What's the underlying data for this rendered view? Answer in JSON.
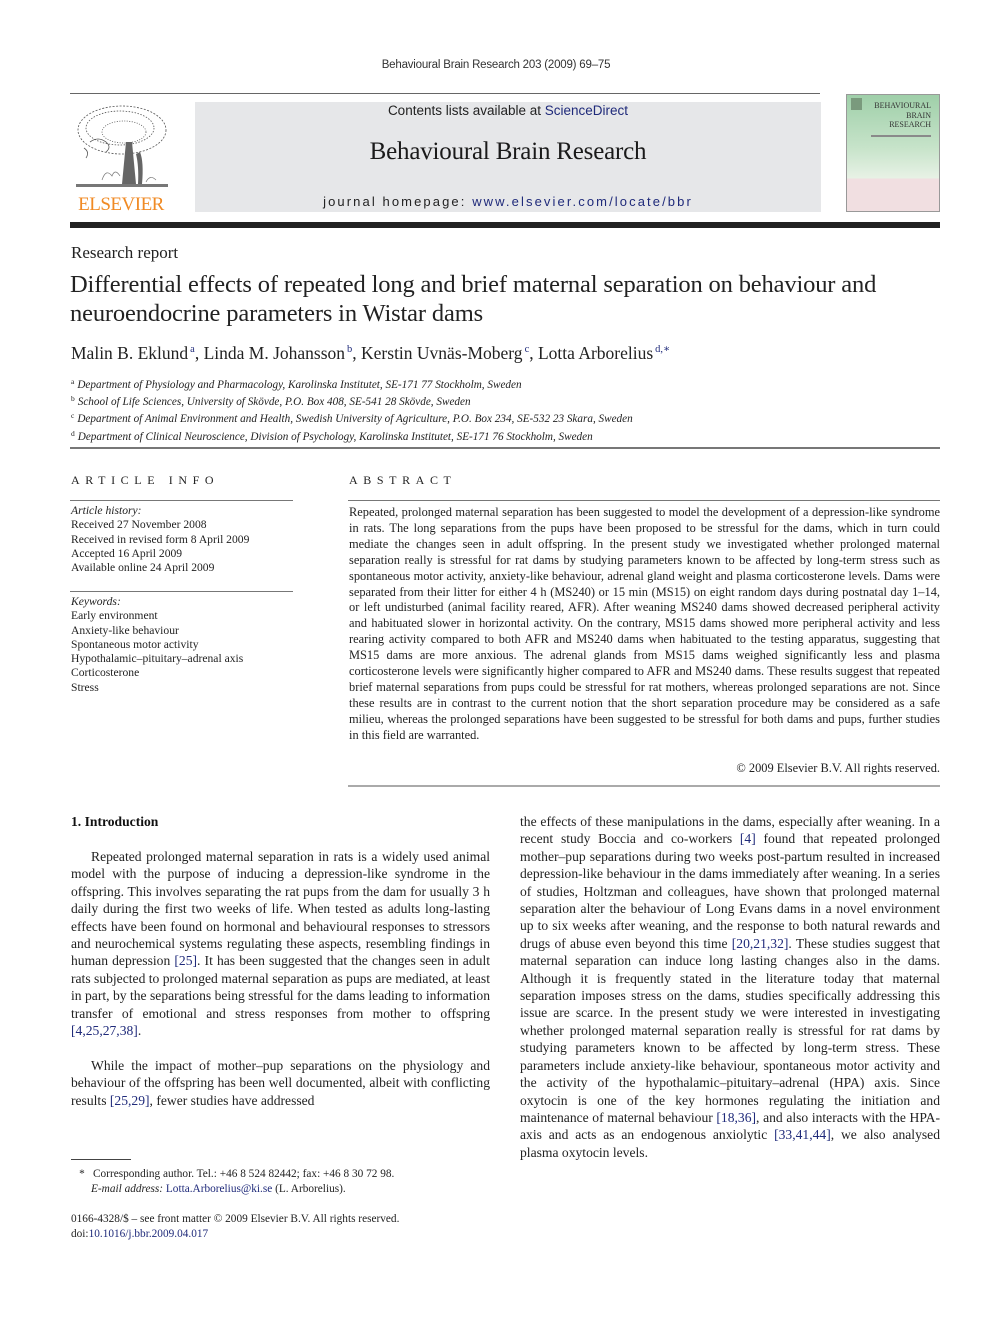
{
  "running_head": "Behavioural Brain Research 203 (2009) 69–75",
  "publisher": {
    "logo_word": "ELSEVIER",
    "logo_color": "#f08a24"
  },
  "banner": {
    "contents_prefix": "Contents lists available at ",
    "contents_link": "ScienceDirect",
    "journal_title": "Behavioural Brain Research",
    "homepage_prefix": "journal homepage: ",
    "homepage_link": "www.elsevier.com/locate/bbr",
    "background": "#e6e7e9"
  },
  "cover": {
    "line1": "BEHAVIOURAL",
    "line2": "BRAIN",
    "line3": "RESEARCH"
  },
  "article": {
    "type": "Research report",
    "title": "Differential effects of repeated long and brief maternal separation on behaviour and neuroendocrine parameters in Wistar dams",
    "authors": [
      {
        "name": "Malin B. Eklund",
        "mark": "a",
        "sep": ", "
      },
      {
        "name": "Linda M. Johansson",
        "mark": "b",
        "sep": ", "
      },
      {
        "name": "Kerstin Uvnäs-Moberg",
        "mark": "c",
        "sep": ", "
      },
      {
        "name": "Lotta Arborelius",
        "mark": "d,∗",
        "sep": ""
      }
    ],
    "affiliations": [
      {
        "mark": "a",
        "text": "Department of Physiology and Pharmacology, Karolinska Institutet, SE-171 77 Stockholm, Sweden"
      },
      {
        "mark": "b",
        "text": "School of Life Sciences, University of Skövde, P.O. Box 408, SE-541 28 Skövde, Sweden"
      },
      {
        "mark": "c",
        "text": "Department of Animal Environment and Health, Swedish University of Agriculture, P.O. Box 234, SE-532 23 Skara, Sweden"
      },
      {
        "mark": "d",
        "text": "Department of Clinical Neuroscience, Division of Psychology, Karolinska Institutet, SE-171 76 Stockholm, Sweden"
      }
    ]
  },
  "article_info": {
    "heading": "ARTICLE INFO",
    "history_label": "Article history:",
    "history": [
      "Received 27 November 2008",
      "Received in revised form 8 April 2009",
      "Accepted 16 April 2009",
      "Available online 24 April 2009"
    ],
    "keywords_label": "Keywords:",
    "keywords": [
      "Early environment",
      "Anxiety-like behaviour",
      "Spontaneous motor activity",
      "Hypothalamic–pituitary–adrenal axis",
      "Corticosterone",
      "Stress"
    ]
  },
  "abstract": {
    "heading": "ABSTRACT",
    "text": "Repeated, prolonged maternal separation has been suggested to model the development of a depression-like syndrome in rats. The long separations from the pups have been proposed to be stressful for the dams, which in turn could mediate the changes seen in adult offspring. In the present study we investigated whether prolonged maternal separation really is stressful for rat dams by studying parameters known to be affected by long-term stress such as spontaneous motor activity, anxiety-like behaviour, adrenal gland weight and plasma corticosterone levels. Dams were separated from their litter for either 4 h (MS240) or 15 min (MS15) on eight random days during postnatal day 1–14, or left undisturbed (animal facility reared, AFR). After weaning MS240 dams showed decreased peripheral activity and habituated slower in horizontal activity. On the contrary, MS15 dams showed more peripheral activity and less rearing activity compared to both AFR and MS240 dams when habituated to the testing apparatus, suggesting that MS15 dams are more anxious. The adrenal glands from MS15 dams weighed significantly less and plasma corticosterone levels were significantly higher compared to AFR and MS240 dams. These results suggest that repeated brief maternal separations from pups could be stressful for rat mothers, whereas prolonged separations are not. Since these results are in contrast to the current notion that the short separation procedure may be considered as a safe milieu, whereas the prolonged separations have been suggested to be stressful for both dams and pups, further studies in this field are warranted.",
    "copyright": "© 2009 Elsevier B.V. All rights reserved."
  },
  "introduction": {
    "heading": "1.  Introduction",
    "p1": [
      {
        "t": "Repeated prolonged maternal separation in rats is a widely used animal model with the purpose of inducing a depression-like syndrome in the offspring. This involves separating the rat pups from the dam for usually 3 h daily during the first two weeks of life. When tested as adults long-lasting effects have been found on hormonal and behavioural responses to stressors and neurochemical systems regulating these aspects, resembling findings in human depression "
      },
      {
        "t": "[25]",
        "ref": true
      },
      {
        "t": ". It has been suggested that the changes seen in adult rats subjected to prolonged maternal separation as pups are mediated, at least in part, by the separations being stressful for the dams leading to information transfer of emotional and stress responses from mother to offspring "
      },
      {
        "t": "[4,25,27,38]",
        "ref": true
      },
      {
        "t": "."
      }
    ],
    "p2": [
      {
        "t": "While the impact of mother–pup separations on the physiology and behaviour of the offspring has been well documented, albeit with conflicting results "
      },
      {
        "t": "[25,29]",
        "ref": true
      },
      {
        "t": ", fewer studies have addressed"
      }
    ],
    "p3": [
      {
        "t": "the effects of these manipulations in the dams, especially after weaning. In a recent study Boccia and co-workers "
      },
      {
        "t": "[4]",
        "ref": true
      },
      {
        "t": " found that repeated prolonged mother–pup separations during two weeks post-partum resulted in increased depression-like behaviour in the dams immediately after weaning. In a series of studies, Holtzman and colleagues, have shown that prolonged maternal separation alter the behaviour of Long Evans dams in a novel environment up to six weeks after weaning, and the response to both natural rewards and drugs of abuse even beyond this time "
      },
      {
        "t": "[20,21,32]",
        "ref": true
      },
      {
        "t": ". These studies suggest that maternal separation can induce long lasting changes also in the dams. Although it is frequently stated in the literature today that maternal separation imposes stress on the dams, studies specifically addressing this issue are scarce. In the present study we were interested in investigating whether prolonged maternal separation really is stressful for rat dams by studying parameters known to be affected by long-term stress. These parameters include anxiety-like behaviour, spontaneous motor activity and the activity of the hypothalamic–pituitary–adrenal (HPA) axis. Since oxytocin is one of the key hormones regulating the initiation and maintenance of maternal behaviour "
      },
      {
        "t": "[18,36]",
        "ref": true
      },
      {
        "t": ", and also interacts with the HPA-axis and acts as an endogenous anxiolytic "
      },
      {
        "t": "[33,41,44]",
        "ref": true
      },
      {
        "t": ", we also analysed plasma oxytocin levels."
      }
    ]
  },
  "footnote": {
    "star": "*",
    "corresponding": "Corresponding author. Tel.: +46 8 524 82442; fax: +46 8 30 72 98.",
    "email_label": "E-mail address:",
    "email": "Lotta.Arborelius@ki.se",
    "email_suffix": " (L. Arborelius)."
  },
  "front_matter": {
    "issn_line": "0166-4328/$ – see front matter © 2009 Elsevier B.V. All rights reserved.",
    "doi_prefix": "doi:",
    "doi": "10.1016/j.bbr.2009.04.017"
  },
  "colors": {
    "link": "#1f2a7a",
    "rule_dark": "#222222"
  }
}
